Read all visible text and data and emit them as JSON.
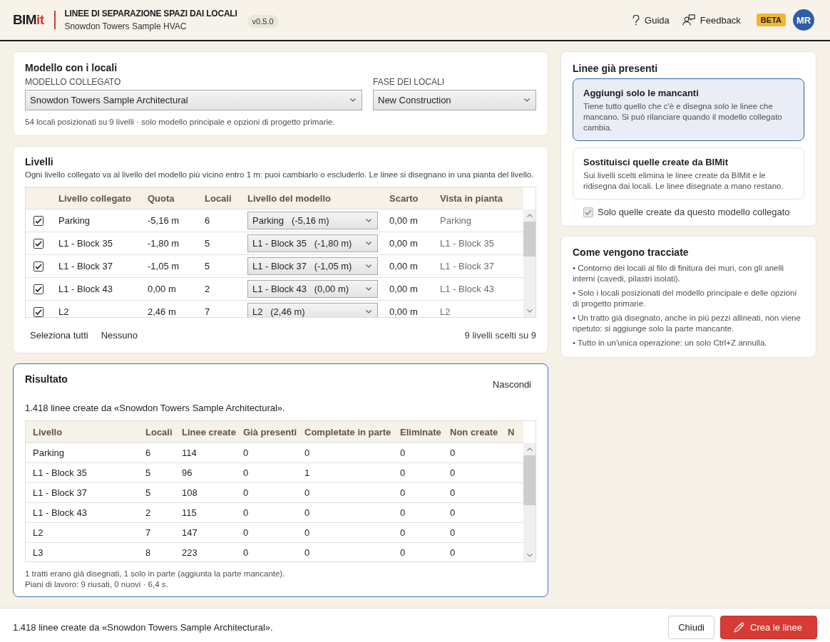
{
  "header": {
    "logo": {
      "main": "BIM",
      "accent": "it"
    },
    "title": "LINEE DI SEPARAZIONE SPAZI DAI LOCALI",
    "subtitle": "Snowdon Towers Sample HVAC",
    "version": "v0.5.0",
    "links": [
      {
        "kind": "help",
        "label": "Guida"
      },
      {
        "kind": "feedback",
        "label": "Feedback"
      }
    ],
    "badge": "BETA",
    "avatar": "MR"
  },
  "model_card": {
    "title": "Modello con i locali",
    "fields": [
      {
        "label": "MODELLO COLLEGATO",
        "value": "Snowdon Towers Sample Architectural"
      },
      {
        "label": "FASE DEI LOCALI",
        "value": "New Construction"
      }
    ],
    "note": "54 locali posizionati su 9 livelli · solo modello principale e opzioni di progetto primarie."
  },
  "levels_card": {
    "title": "Livelli",
    "description": "Ogni livello collegato va al livello del modello più vicino entro 1 m: puoi cambiarlo o escluderlo. Le linee si disegnano in una pianta del livello.",
    "table": {
      "columns": [
        "Livello collegato",
        "Quota",
        "Locali",
        "Livello del modello",
        "Scarto",
        "Vista in pianta"
      ],
      "rows": [
        {
          "checked": true,
          "linked_level": "Parking",
          "elevation": "-5,16 m",
          "rooms": "6",
          "model_level": "Parking   (-5,16 m)",
          "offset": "0,00 m",
          "plan_view": "Parking"
        },
        {
          "checked": true,
          "linked_level": "L1 - Block 35",
          "elevation": "-1,80 m",
          "rooms": "5",
          "model_level": "L1 - Block 35   (-1,80 m)",
          "offset": "0,00 m",
          "plan_view": "L1 - Block 35"
        },
        {
          "checked": true,
          "linked_level": "L1 - Block 37",
          "elevation": "-1,05 m",
          "rooms": "5",
          "model_level": "L1 - Block 37   (-1,05 m)",
          "offset": "0,00 m",
          "plan_view": "L1 - Block 37"
        },
        {
          "checked": true,
          "linked_level": "L1 - Block 43",
          "elevation": "0,00 m",
          "rooms": "2",
          "model_level": "L1 - Block 43   (0,00 m)",
          "offset": "0,00 m",
          "plan_view": "L1 - Block 43"
        },
        {
          "checked": true,
          "linked_level": "L2",
          "elevation": "2,46 m",
          "rooms": "7",
          "model_level": "L2   (2,46 m)",
          "offset": "0,00 m",
          "plan_view": "L2"
        }
      ]
    },
    "actions": [
      "Seleziona tutti",
      "Nessuno"
    ],
    "count": "9 livelli scelti su 9"
  },
  "result_card": {
    "title": "Risultato",
    "hide_action": "Nascondi",
    "summary": "1.418 linee create da «Snowdon Towers Sample Architectural».",
    "table": {
      "columns": [
        "Livello",
        "Locali",
        "Linee create",
        "Già presenti",
        "Completate in parte",
        "Eliminate",
        "Non create",
        "N"
      ],
      "rows": [
        [
          "Parking",
          "6",
          "114",
          "0",
          "0",
          "0",
          "0"
        ],
        [
          "L1 - Block 35",
          "5",
          "96",
          "0",
          "1",
          "0",
          "0"
        ],
        [
          "L1 - Block 37",
          "5",
          "108",
          "0",
          "0",
          "0",
          "0"
        ],
        [
          "L1 - Block 43",
          "2",
          "115",
          "0",
          "0",
          "0",
          "0"
        ],
        [
          "L2",
          "7",
          "147",
          "0",
          "0",
          "0",
          "0"
        ],
        [
          "L3",
          "8",
          "223",
          "0",
          "0",
          "0",
          "0"
        ]
      ]
    },
    "notes": [
      "1 tratti erano già disegnati, 1 solo in parte (aggiunta la parte mancante).",
      "Piani di lavoro: 9 riusati, 0 nuovi · 6,4 s."
    ]
  },
  "existing_lines_card": {
    "title": "Linee già presenti",
    "options": [
      {
        "title": "Aggiungi solo le mancanti",
        "description": "Tiene tutto quello che c'è e disegna solo le linee che mancano. Si può rilanciare quando il modello collegato cambia.",
        "selected": true
      },
      {
        "title": "Sostituisci quelle create da BIMit",
        "description": "Sui livelli scelti elimina le linee create da BIMit e le ridisegna dai locali. Le linee disegnate a mano restano.",
        "selected": false
      }
    ],
    "only_this_model": {
      "label": "Solo quelle create da questo modello collegato",
      "checked": true,
      "disabled": true
    }
  },
  "how_card": {
    "title": "Come vengono tracciate",
    "bullets": [
      "• Contorno dei locali al filo di finitura dei muri, con gli anelli interni (cavedi, pilastri isolati).",
      "• Solo i locali posizionati del modello principale e delle opzioni di progetto primarie.",
      "• Un tratto già disegnato, anche in più pezzi allineati, non viene ripetuto: si aggiunge solo la parte mancante.",
      "• Tutto in un'unica operazione: un solo Ctrl+Z annulla."
    ]
  },
  "footer": {
    "status": "1.418 linee create da «Snowdon Towers Sample Architectural».",
    "buttons": [
      {
        "kind": "secondary",
        "label": "Chiudi"
      },
      {
        "kind": "primary",
        "label": "Crea le linee"
      }
    ]
  }
}
